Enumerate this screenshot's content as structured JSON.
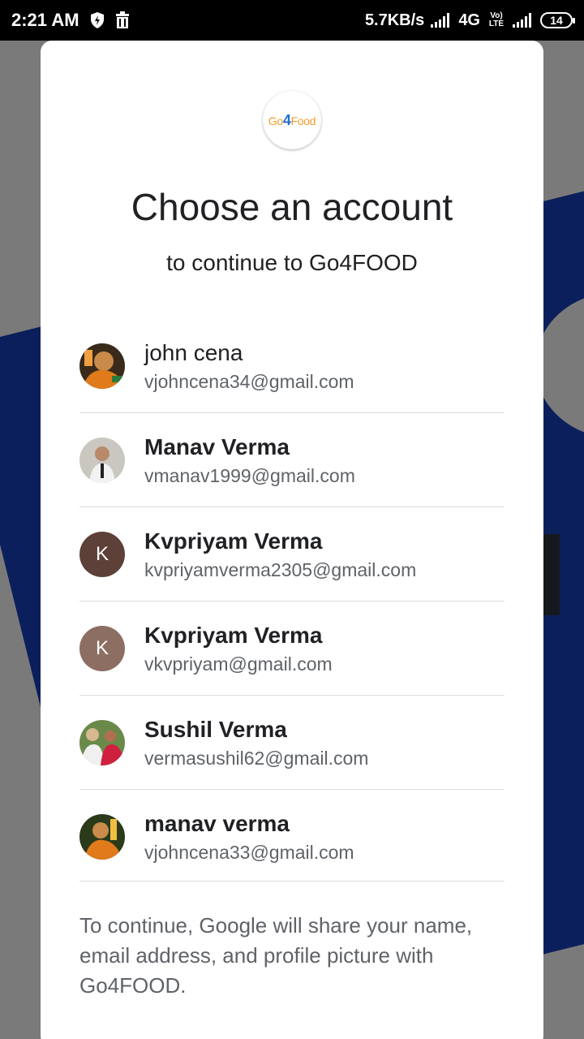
{
  "status_bar": {
    "time": "2:21 AM",
    "net_speed": "5.7KB/s",
    "network": "4G",
    "volte": "Vo) LTE",
    "battery": "14",
    "icons": [
      "shield-icon",
      "trash-icon",
      "signal-icon",
      "battery-icon"
    ]
  },
  "dialog": {
    "logo_text_a": "Go",
    "logo_text_b": "4",
    "logo_text_c": "Food",
    "title": "Choose an account",
    "subtitle": "to continue to Go4FOOD",
    "accounts": [
      {
        "name": "john cena",
        "email": "vjohncena34@gmail.com",
        "avatar": "photo"
      },
      {
        "name": "Manav Verma",
        "email": "vmanav1999@gmail.com",
        "avatar": "photo"
      },
      {
        "name": "Kvpriyam Verma",
        "email": "kvpriyamverma2305@gmail.com",
        "avatar_letter": "K",
        "avatar_color": "#5d4037"
      },
      {
        "name": "Kvpriyam Verma",
        "email": "vkvpriyam@gmail.com",
        "avatar_letter": "K",
        "avatar_color": "#8d6e63"
      },
      {
        "name": "Sushil Verma",
        "email": "vermasushil62@gmail.com",
        "avatar": "photo"
      },
      {
        "name": "manav verma",
        "email": "vjohncena33@gmail.com",
        "avatar": "photo"
      }
    ],
    "disclaimer": "To continue, Google will share your name, email address, and profile picture with Go4FOOD."
  }
}
